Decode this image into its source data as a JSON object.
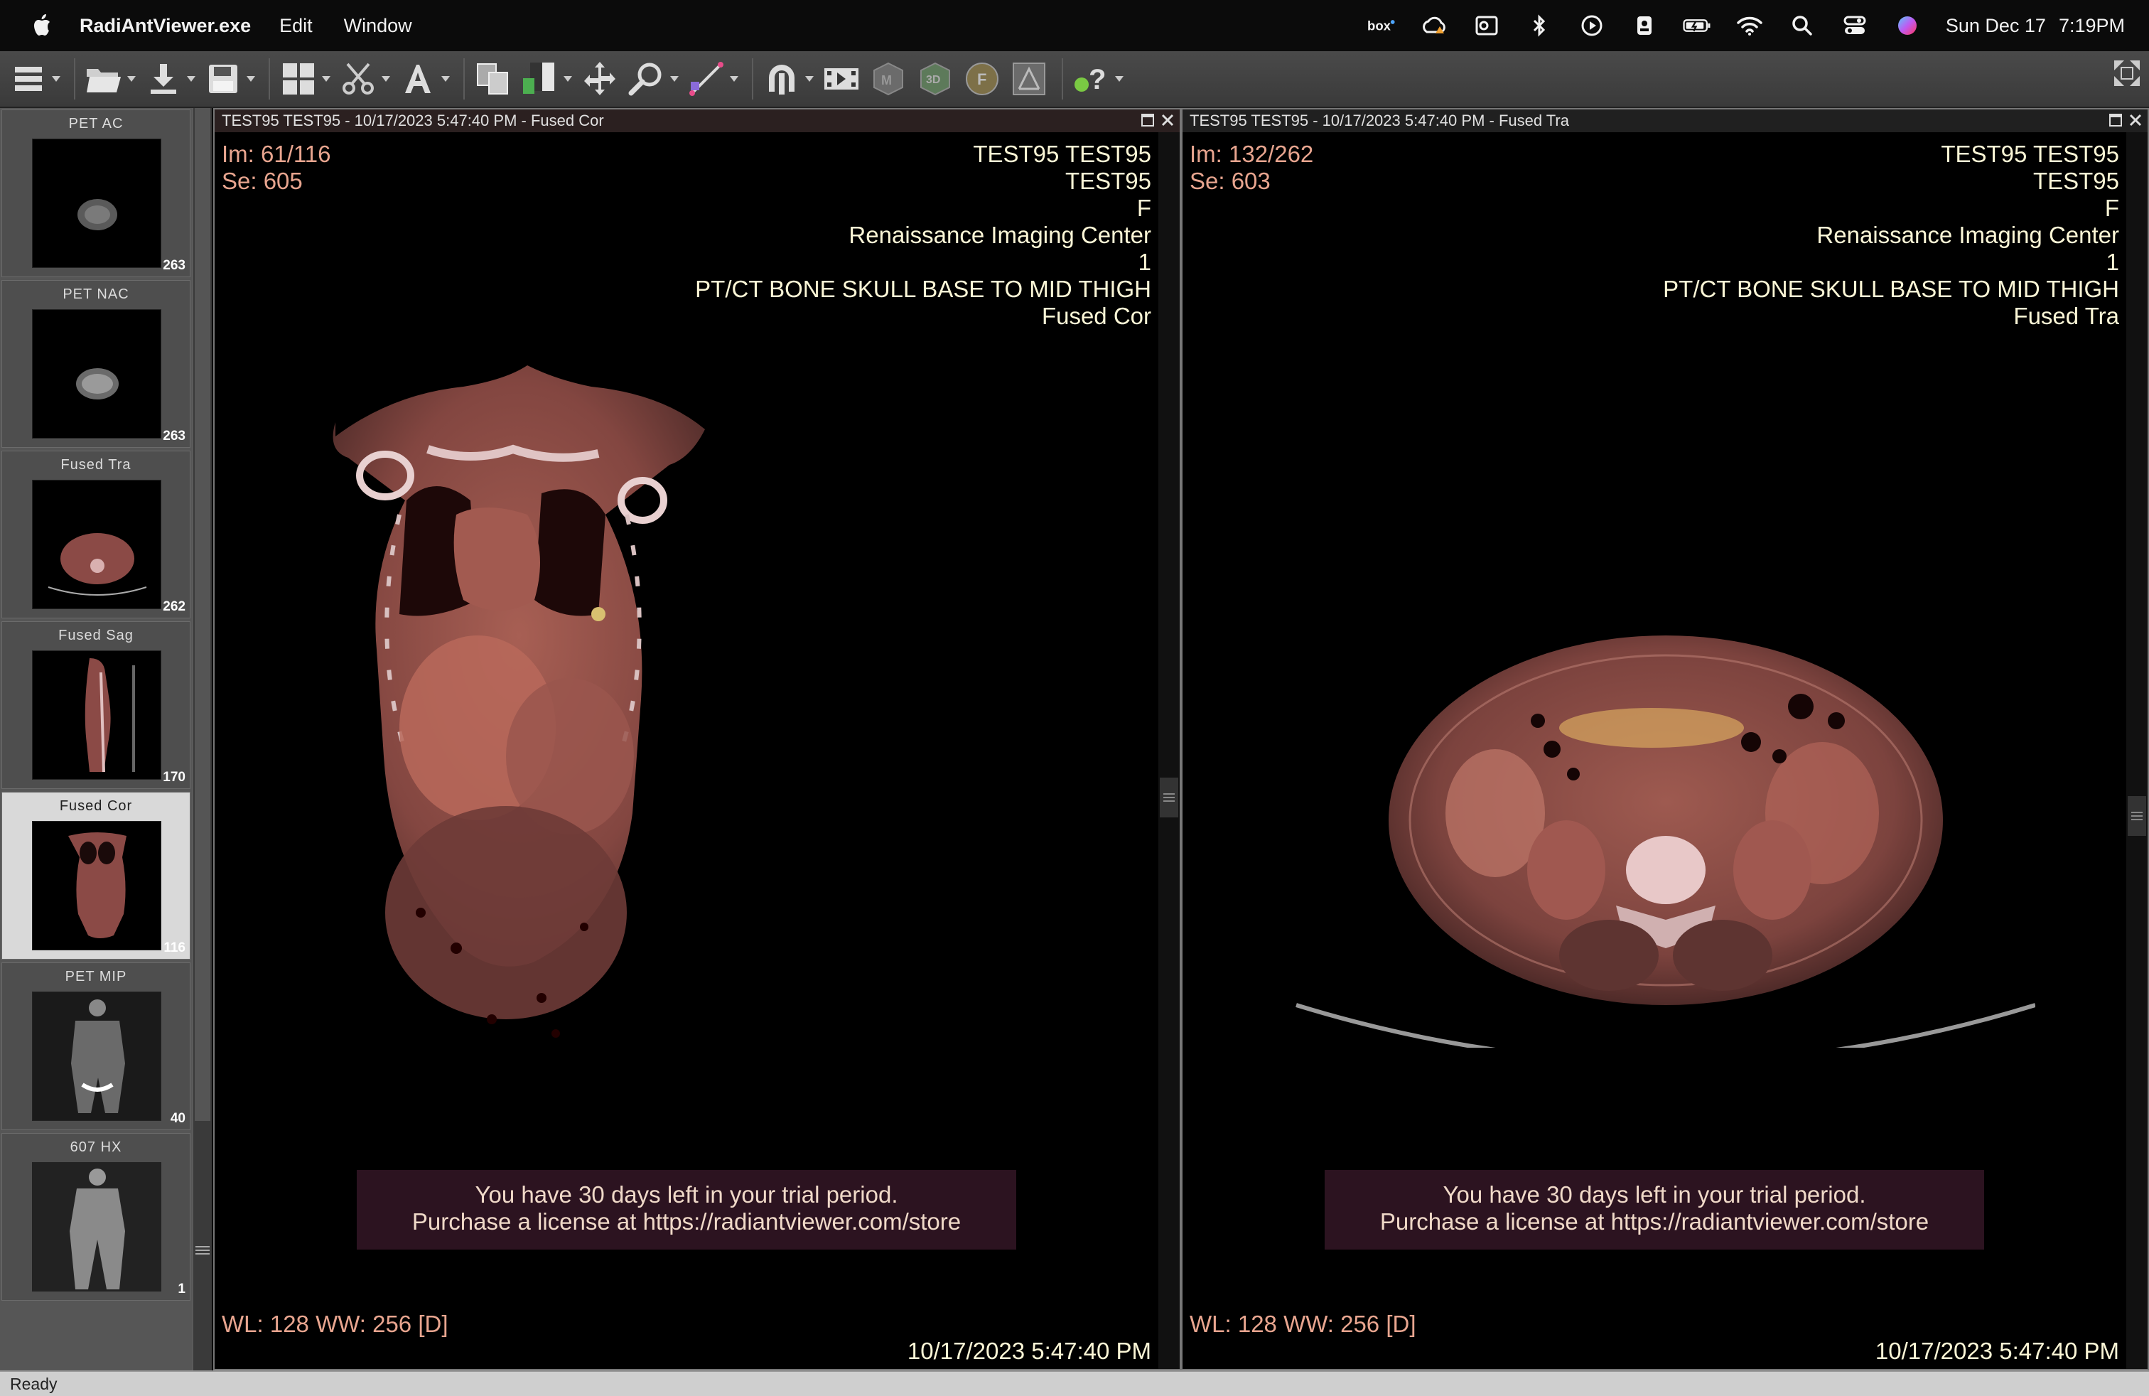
{
  "menubar": {
    "app_name": "RadiAntViewer.exe",
    "menus": [
      "Edit",
      "Window"
    ],
    "status_icons": [
      "box-icon",
      "creative-cloud-icon",
      "outlook-icon",
      "bluetooth-icon",
      "play-icon",
      "badge-icon",
      "battery-icon",
      "wifi-icon",
      "search-icon",
      "control-center-icon",
      "siri-icon"
    ],
    "date": "Sun Dec 17",
    "time": "7:19PM"
  },
  "toolbar": {
    "tools": [
      "menu-icon",
      "open-folder-icon",
      "download-icon",
      "save-icon",
      "layout-grid-icon",
      "scissors-icon",
      "text-annotation-icon",
      "copy-series-icon",
      "window-level-icon",
      "pan-icon",
      "zoom-icon",
      "measure-icon",
      "dicom-tags-icon",
      "cine-icon",
      "mpr-icon",
      "3d-icon",
      "fusion-icon",
      "pet-icon",
      "help-icon"
    ],
    "fullscreen": "fullscreen-icon"
  },
  "sidebar": {
    "thumbnails": [
      {
        "label": "PET AC",
        "count": "263"
      },
      {
        "label": "PET NAC",
        "count": "263"
      },
      {
        "label": "Fused Tra",
        "count": "262"
      },
      {
        "label": "Fused Sag",
        "count": "170"
      },
      {
        "label": "Fused Cor",
        "count": "116"
      },
      {
        "label": "PET MIP",
        "count": "40"
      },
      {
        "label": "607 HX",
        "count": "1"
      }
    ],
    "selected_index": 4
  },
  "viewports": [
    {
      "title": "TEST95 TEST95  - 10/17/2023 5:47:40 PM - Fused Cor",
      "image_number": "Im: 61/116",
      "series": "Se: 605",
      "patient_name": "TEST95 TEST95",
      "patient_id": "TEST95",
      "sex": "F",
      "institution": "Renaissance Imaging Center",
      "acquisition": "1",
      "study": "PT/CT BONE SKULL BASE TO MID THIGH",
      "series_desc": "Fused Cor",
      "window": "WL: 128 WW: 256 [D]",
      "datetime": "10/17/2023 5:47:40 PM",
      "trial_line1": "You have 30 days left in your trial period.",
      "trial_line2": "Purchase a license at https://radiantviewer.com/store"
    },
    {
      "title": "TEST95 TEST95  - 10/17/2023 5:47:40 PM - Fused Tra",
      "image_number": "Im: 132/262",
      "series": "Se: 603",
      "patient_name": "TEST95 TEST95",
      "patient_id": "TEST95",
      "sex": "F",
      "institution": "Renaissance Imaging Center",
      "acquisition": "1",
      "study": "PT/CT BONE SKULL BASE TO MID THIGH",
      "series_desc": "Fused Tra",
      "window": "WL: 128 WW: 256 [D]",
      "datetime": "10/17/2023 5:47:40 PM",
      "trial_line1": "You have 30 days left in your trial period.",
      "trial_line2": "Purchase a license at https://radiantviewer.com/store"
    }
  ],
  "statusbar": {
    "text": "Ready"
  },
  "colors": {
    "overlay_left": "#e8a58f",
    "overlay_right": "#fbf6d6",
    "tissue": "#8a4a44"
  }
}
